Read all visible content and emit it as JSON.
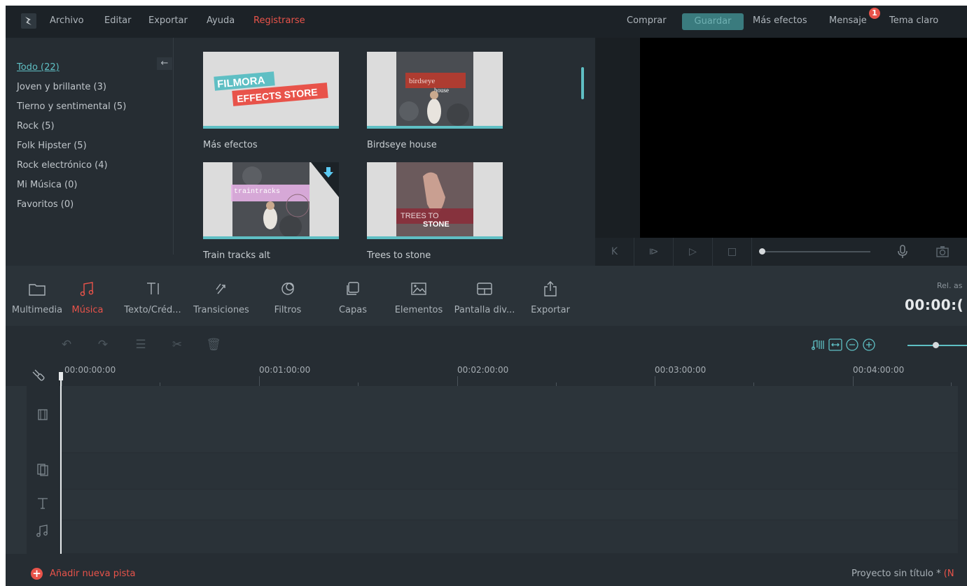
{
  "menu": {
    "archivo": "Archivo",
    "editar": "Editar",
    "exportar": "Exportar",
    "ayuda": "Ayuda",
    "registrarse": "Registrarse"
  },
  "topright": {
    "comprar": "Comprar",
    "guardar": "Guardar",
    "mas_efectos": "Más efectos",
    "mensaje": "Mensaje",
    "mensaje_badge": "1",
    "tema_claro": "Tema claro"
  },
  "categories": [
    {
      "label": "Todo (22)",
      "active": true
    },
    {
      "label": "Joven y brillante (3)"
    },
    {
      "label": "Tierno y sentimental (5)"
    },
    {
      "label": "Rock (5)"
    },
    {
      "label": "Folk Hipster (5)"
    },
    {
      "label": "Rock electrónico (4)"
    },
    {
      "label": "Mi Música (0)"
    },
    {
      "label": "Favoritos (0)"
    }
  ],
  "back_arrow": "←",
  "effects": [
    {
      "label": "Más efectos",
      "art_line1": "FILMORA",
      "art_line2": "EFFECTS STORE"
    },
    {
      "label": "Birdseye house",
      "art_line1": "birdseye",
      "art_line2": "house"
    },
    {
      "label": "Train tracks alt",
      "art_line1": "traintracks"
    },
    {
      "label": "Trees to stone",
      "art_line1": "TREES TO",
      "art_line2": "STONE"
    }
  ],
  "tabs": [
    {
      "label": "Multimedia",
      "icon": "folder-icon"
    },
    {
      "label": "Música",
      "icon": "music-icon",
      "active": true
    },
    {
      "label": "Texto/Créd...",
      "icon": "text-icon"
    },
    {
      "label": "Transiciones",
      "icon": "transition-icon"
    },
    {
      "label": "Filtros",
      "icon": "filter-icon"
    },
    {
      "label": "Capas",
      "icon": "layers-icon"
    },
    {
      "label": "Elementos",
      "icon": "image-icon"
    },
    {
      "label": "Pantalla div...",
      "icon": "split-screen-icon"
    },
    {
      "label": "Exportar",
      "icon": "export-icon"
    }
  ],
  "rel_label": "Rel. as",
  "timecode": "00:00:(",
  "ruler": [
    "00:00:00:00",
    "00:01:00:00",
    "00:02:00:00",
    "00:03:00:00",
    "00:04:00:00"
  ],
  "bottom": {
    "add_track": "Añadir nueva pista",
    "project_title": "Proyecto sin título *",
    "project_suffix": "(N"
  },
  "colors": {
    "accent": "#5fbfc4",
    "red": "#e8534a",
    "bg": "#262d33",
    "topbar": "#1c2227"
  }
}
